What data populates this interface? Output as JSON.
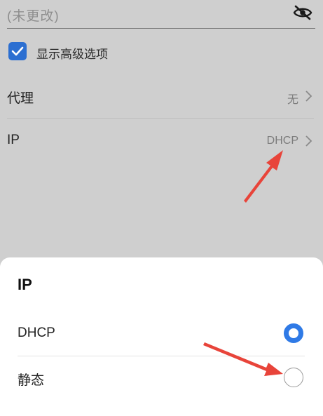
{
  "background_page": {
    "password": {
      "value": "(未更改)",
      "toggle_icon": "eye-slash-icon"
    },
    "advanced_options": {
      "label": "显示高级选项",
      "checked": true,
      "color": "#2c6fd1"
    },
    "proxy": {
      "label": "代理",
      "value": "无"
    },
    "ip": {
      "label": "IP",
      "value": "DHCP"
    }
  },
  "ip_dialog": {
    "title": "IP",
    "options": [
      {
        "label": "DHCP",
        "selected": true
      },
      {
        "label": "静态",
        "selected": false
      }
    ],
    "accent_color": "#2f7ae6"
  },
  "annotations": {
    "arrow_color": "#e8443a"
  }
}
